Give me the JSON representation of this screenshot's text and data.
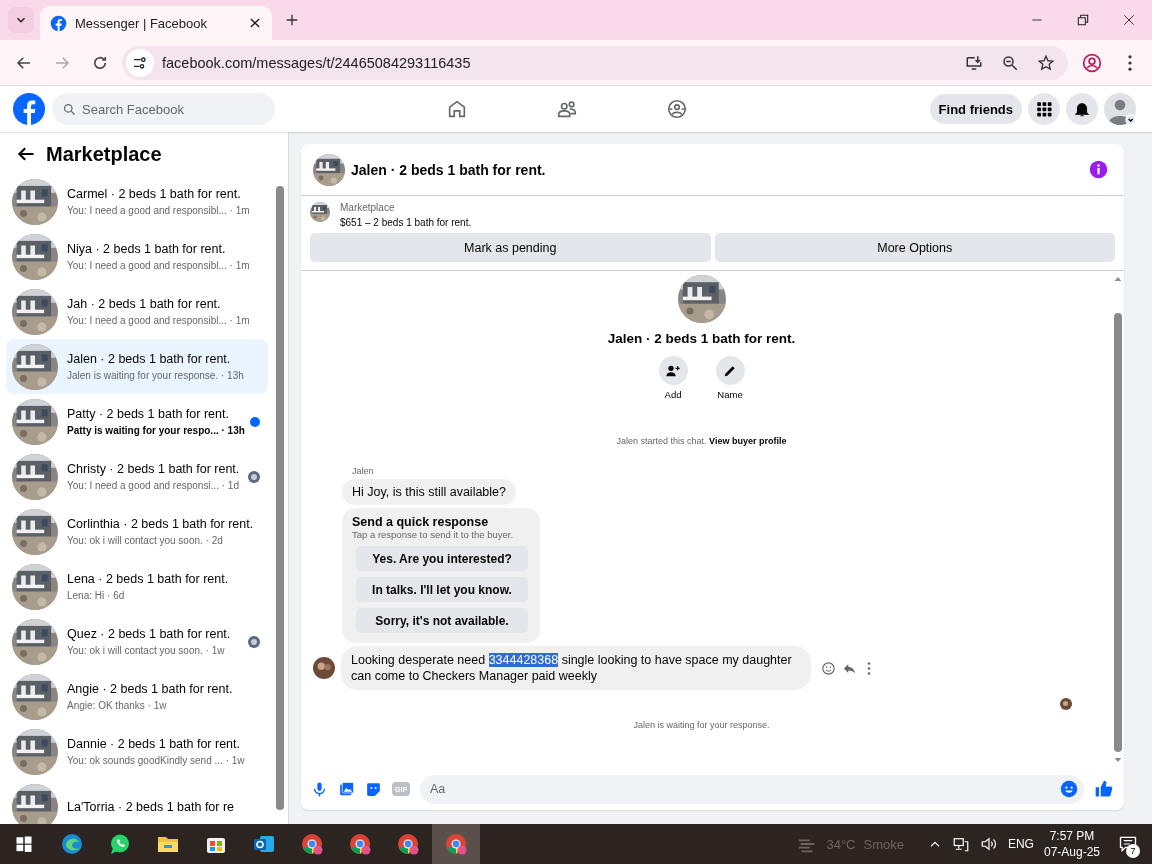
{
  "browser": {
    "tab_title": "Messenger | Facebook",
    "url": "facebook.com/messages/t/24465084293116435"
  },
  "header": {
    "search_placeholder": "Search Facebook",
    "find_friends": "Find friends"
  },
  "sidebar": {
    "title": "Marketplace",
    "conversations": [
      {
        "title": "Carmel · 2 beds 1 bath for rent.",
        "preview": "You: I need a good and responsibl...",
        "time": "· 1m",
        "selected": false,
        "unread": false,
        "seen": false
      },
      {
        "title": "Niya · 2 beds 1 bath for rent.",
        "preview": "You: I need a good and responsibl...",
        "time": "· 1m",
        "selected": false,
        "unread": false,
        "seen": false
      },
      {
        "title": "Jah · 2 beds 1 bath for rent.",
        "preview": "You: I need a good and responsibl...",
        "time": "· 1m",
        "selected": false,
        "unread": false,
        "seen": false
      },
      {
        "title": "Jalen · 2 beds 1 bath for rent.",
        "preview": "Jalen is waiting for your response.",
        "time": "· 13h",
        "selected": true,
        "unread": false,
        "seen": false
      },
      {
        "title": "Patty · 2 beds 1 bath for rent.",
        "preview": "Patty is waiting for your respo...",
        "time": "· 13h",
        "selected": false,
        "unread": true,
        "seen": false
      },
      {
        "title": "Christy · 2 beds 1 bath for rent.",
        "preview": "You: I need a good and responsi...",
        "time": "· 1d",
        "selected": false,
        "unread": false,
        "seen": true
      },
      {
        "title": "Corlinthia · 2 beds 1 bath for rent.",
        "preview": "You: ok i will contact you soon.",
        "time": "· 2d",
        "selected": false,
        "unread": false,
        "seen": false
      },
      {
        "title": "Lena · 2 beds 1 bath for rent.",
        "preview": "Lena: Hi",
        "time": "· 6d",
        "selected": false,
        "unread": false,
        "seen": false
      },
      {
        "title": "Quez · 2 beds 1 bath for rent.",
        "preview": "You: ok i will contact you soon.",
        "time": "· 1w",
        "selected": false,
        "unread": false,
        "seen": true
      },
      {
        "title": "Angie · 2 beds 1 bath for rent.",
        "preview": "Angie: OK thanks",
        "time": "· 1w",
        "selected": false,
        "unread": false,
        "seen": false
      },
      {
        "title": "Dannie · 2 beds 1 bath for rent.",
        "preview": "You: ok sounds goodKindly send ...",
        "time": "· 1w",
        "selected": false,
        "unread": false,
        "seen": false
      },
      {
        "title": "La'Torria · 2 beds 1 bath for re",
        "selected": false
      }
    ]
  },
  "chat": {
    "title": "Jalen · 2 beds 1 bath for rent.",
    "listing": {
      "label": "Marketplace",
      "price_title": "$651 – 2 beds 1 bath for rent."
    },
    "actions": [
      "Mark as pending",
      "More Options"
    ],
    "intro": {
      "title": "Jalen · 2 beds 1 bath for rent.",
      "buttons": [
        {
          "label": "Add",
          "kind": "add"
        },
        {
          "label": "Name",
          "kind": "name"
        }
      ]
    },
    "system": {
      "text": "Jalen started this chat.",
      "link": "View buyer profile"
    },
    "sender": "Jalen",
    "first_message": "Hi Joy, is this still available?",
    "quick_response": {
      "title": "Send a quick response",
      "subtitle": "Tap a response to send it to the buyer.",
      "options": [
        "Yes. Are you interested?",
        "In talks. I'll let you know.",
        "Sorry, it's not available."
      ]
    },
    "last_message": {
      "before": "Looking desperate need ",
      "highlight": "3344428368",
      "after": " single looking to have space my daughter can come to Checkers Manager paid weekly"
    },
    "status": "Jalen is waiting for your response.",
    "composer": {
      "placeholder": "Aa",
      "gif": "GIF"
    }
  },
  "taskbar": {
    "apps": [
      {
        "kind": "edge",
        "selected": false
      },
      {
        "kind": "whatsapp",
        "selected": false
      },
      {
        "kind": "folder",
        "selected": false
      },
      {
        "kind": "store",
        "selected": false
      },
      {
        "kind": "outlook",
        "selected": false
      },
      {
        "kind": "chrome",
        "selected": false
      },
      {
        "kind": "chrome",
        "selected": false
      },
      {
        "kind": "chrome",
        "selected": false
      },
      {
        "kind": "chrome",
        "selected": true
      }
    ],
    "temperature": "34°C",
    "weather": "Smoke",
    "language": "ENG",
    "time": "7:57 PM",
    "date": "07-Aug-25",
    "notifications": "7"
  }
}
